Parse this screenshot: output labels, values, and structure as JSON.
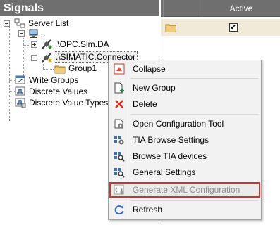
{
  "left_panel": {
    "title": "Signals",
    "tree": {
      "server_list": ".",
      "server_list_label": "Server List",
      "root_dot": ".",
      "opc_sim": ".\\OPC.Sim.DA",
      "siematic_connector": ".\\SIMATIC.Connector",
      "group1": "Group1",
      "write_groups": "Write Groups",
      "discrete_values": "Discrete Values",
      "discrete_value_types": "Discrete Value Types"
    }
  },
  "right_panel": {
    "column_header": "Active",
    "row": {
      "active_checked": true,
      "check_glyph": "✔"
    }
  },
  "context_menu": {
    "items": [
      {
        "label": "Collapse",
        "icon": "collapse-icon"
      },
      {
        "label": "New Group",
        "icon": "new-group-icon"
      },
      {
        "label": "Delete",
        "icon": "delete-icon"
      },
      {
        "label": "Open Configuration Tool",
        "icon": "configuration-tool-icon"
      },
      {
        "label": "TIA Browse Settings",
        "icon": "tia-browse-settings-icon"
      },
      {
        "label": "Browse TIA devices",
        "icon": "browse-tia-devices-icon"
      },
      {
        "label": "General Settings",
        "icon": "general-settings-icon"
      },
      {
        "label": "Generate XML Configuration",
        "icon": "xml-configuration-icon",
        "disabled": true,
        "highlighted": true
      },
      {
        "label": "Refresh",
        "icon": "refresh-icon"
      }
    ]
  },
  "colors": {
    "header_bg": "#6f6f6f",
    "row_bg": "#f2ead8",
    "menu_bg": "#f2f2f2",
    "highlight_border": "#d32f2f",
    "disabled_text": "#8d8d8d"
  }
}
